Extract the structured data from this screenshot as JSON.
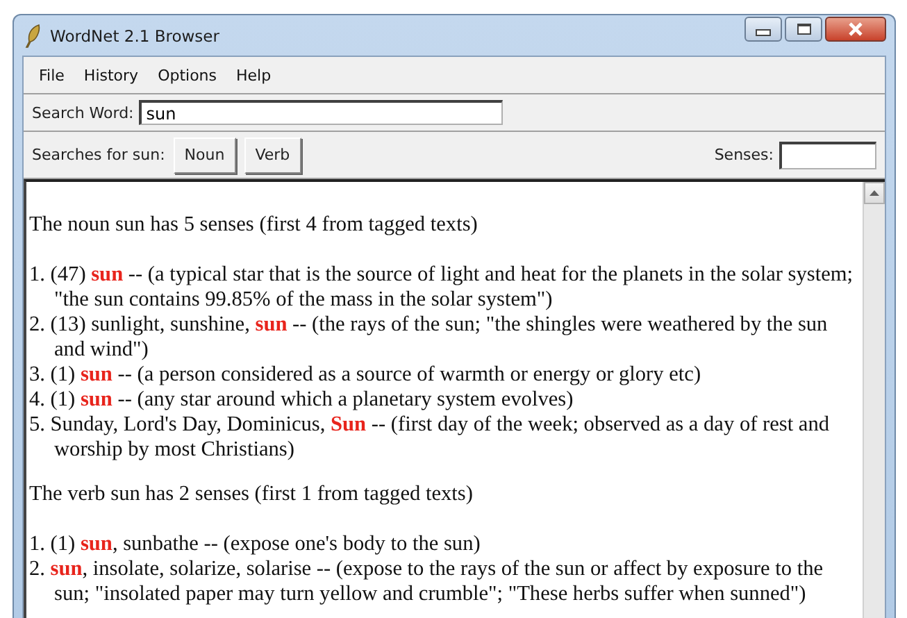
{
  "window": {
    "title": "WordNet 2.1 Browser"
  },
  "menu": [
    "File",
    "History",
    "Options",
    "Help"
  ],
  "search": {
    "label": "Search Word:",
    "value": "sun"
  },
  "searches": {
    "label": "Searches for sun:",
    "buttons": [
      "Noun",
      "Verb"
    ],
    "senses_label": "Senses:"
  },
  "results": [
    {
      "heading": "The noun sun has 5 senses (first 4 from tagged texts)",
      "senses": [
        {
          "number": "1.",
          "before": "(47) ",
          "word": "sun",
          "after": " -- (a typical star that is the source of light and heat for the planets in the solar system; \"the sun contains 99.85% of the mass in the solar system\")"
        },
        {
          "number": "2.",
          "before": "(13) sunlight, sunshine, ",
          "word": "sun",
          "after": " -- (the rays of the sun; \"the shingles were weathered by the sun and wind\")"
        },
        {
          "number": "3.",
          "before": "(1) ",
          "word": "sun",
          "after": " -- (a person considered as a source of warmth or energy or glory etc)"
        },
        {
          "number": "4.",
          "before": "(1) ",
          "word": "sun",
          "after": " -- (any star around which a planetary system evolves)"
        },
        {
          "number": "5.",
          "before": "Sunday, Lord's Day, Dominicus, ",
          "word": "Sun",
          "after": " -- (first day of the week; observed as a day of rest and worship by most Christians)"
        }
      ]
    },
    {
      "heading": "The verb sun has 2 senses (first 1 from tagged texts)",
      "senses": [
        {
          "number": "1.",
          "before": "(1) ",
          "word": "sun",
          "after": ", sunbathe -- (expose one's body to the sun)"
        },
        {
          "number": "2.",
          "word": "sun",
          "after": ", insolate, solarize, solarise -- (expose to the rays of the sun or affect by exposure to the sun; \"insolated paper may turn yellow and crumble\"; \"These herbs suffer when sunned\")"
        }
      ]
    }
  ]
}
